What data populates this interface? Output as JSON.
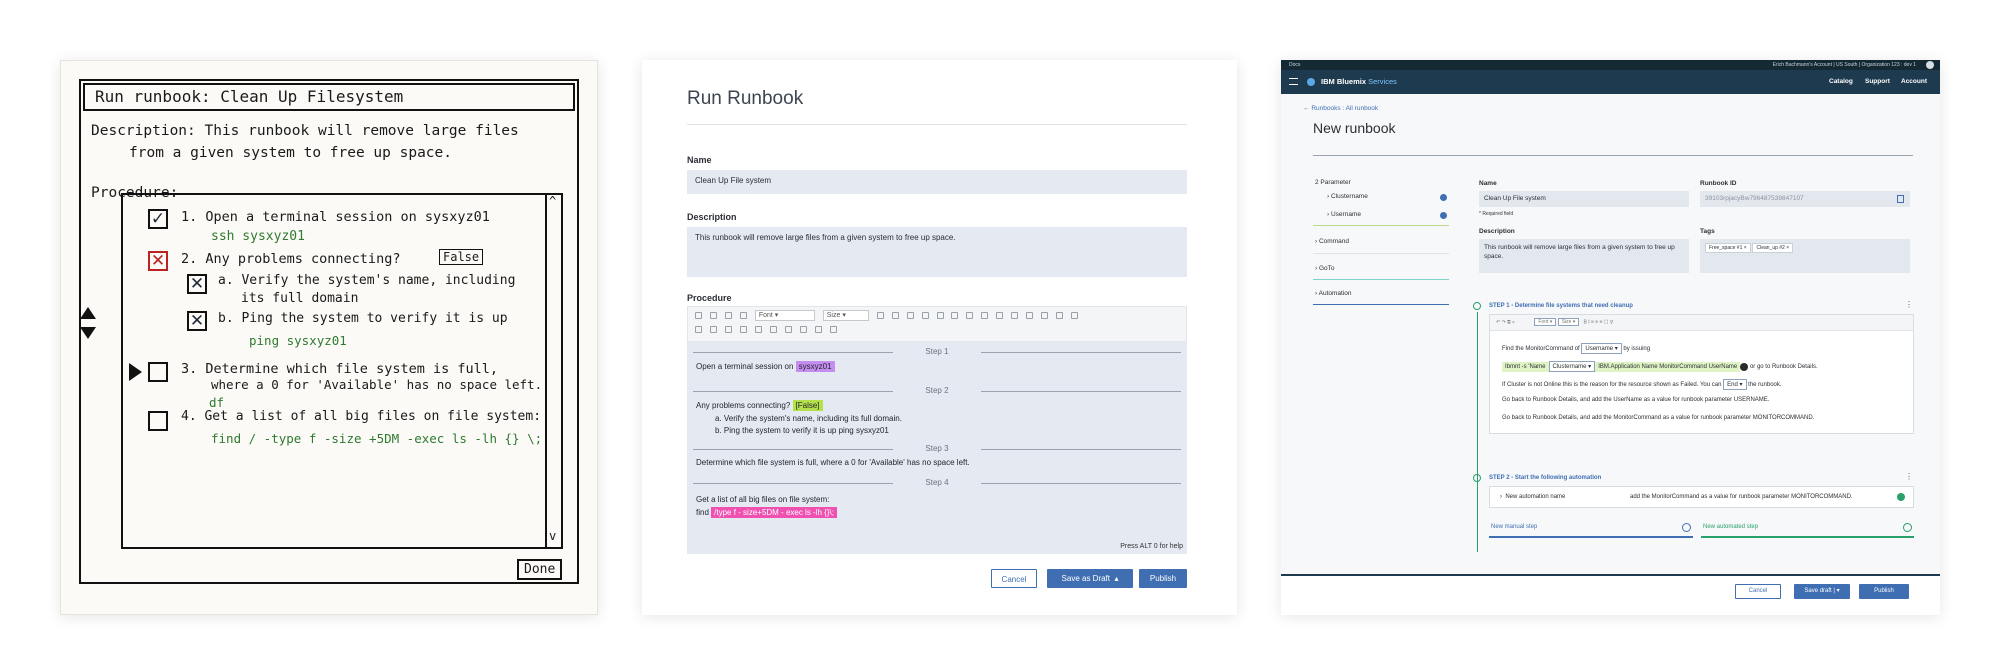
{
  "sketch": {
    "title": "Run runbook: Clean Up Filesystem",
    "description_line1": "Description: This runbook will remove large files",
    "description_line2": "from a given system to free up space.",
    "procedure_label": "Procedure:",
    "step1": "1. Open a terminal session on sysxyz01",
    "step1_cmd": "ssh sysxyz01",
    "step2": "2. Any problems connecting?",
    "step2_flag": "False",
    "step2a_line1": "a. Verify the system's name, including",
    "step2a_line2": "its full domain",
    "step2b": "b. Ping the system to verify it is up",
    "step2b_cmd": "ping sysxyz01",
    "step3_line1": "3. Determine which file system is full,",
    "step3_line2": "where a 0 for 'Available' has no space left.",
    "step3_cmd": "df",
    "step4": "4. Get a list of all big files on file system:",
    "step4_cmd": "find / -type f -size +5DM -exec ls -lh {} \\;",
    "scroll_up": "^",
    "scroll_down": "v",
    "done_label": "Done"
  },
  "middle": {
    "title": "Run Runbook",
    "name_label": "Name",
    "name_value": "Clean Up File system",
    "description_label": "Description",
    "description_value": "This runbook will remove large files from a given system to free up space.",
    "procedure_label": "Procedure",
    "toolbar": {
      "font": "Font",
      "size": "Size"
    },
    "steps": [
      {
        "label": "Step 1"
      },
      {
        "label": "Step 2"
      },
      {
        "label": "Step 3"
      },
      {
        "label": "Step 4"
      }
    ],
    "step1_text": "Open a terminal session on",
    "step1_chip": "sysxyz01",
    "step2_text": "Any problems connecting?",
    "step2_chip": "[False]",
    "step2_a": "a. Verify the system's name, including its full domain.",
    "step2_b": "b. Ping the system to verify it is up ping sysxyz01",
    "step3_text": "Determine which file system is full, where a 0 for 'Available' has no space left.",
    "step4_text": "Get a list of all big files on file system:",
    "step4_prefix": "find",
    "step4_chip": "/type f - size+5DM - exec ls -lh {}\\;",
    "help_text": "Press ALT 0 for help",
    "cancel_label": "Cancel",
    "draft_label": "Save as Draft",
    "publish_label": "Publish",
    "colors": {
      "chip_purple": "#c58df0",
      "chip_green": "#b6e04a",
      "chip_pink": "#f051b1",
      "primary": "#3f6fb2"
    }
  },
  "right": {
    "topbar_left": "Docs",
    "topbar_right": "Erich Bachmann's Account | US South | Organization 123 : dev 1",
    "brand": "IBM Bluemix",
    "brand_suffix": "Services",
    "nav": [
      "Catalog",
      "Support",
      "Account"
    ],
    "breadcrumb": "Runbooks : All runbook",
    "page_title": "New runbook",
    "side": {
      "parameter": "2  Parameter",
      "clustername": "Clustername",
      "username": "Username",
      "command": "Command",
      "goto": "GoTo",
      "automation": "Automation"
    },
    "name_label": "Name",
    "name_value": "Clean Up File system",
    "required": "* Required field",
    "id_label": "Runbook ID",
    "id_value": "39103rpjacyBw796487539847107",
    "desc_label": "Description",
    "desc_value": "This runbook will remove large files from a given system to free up space.",
    "tags_label": "Tags",
    "tags": [
      "Free_space #1 ×",
      "Clean_up #2 ×"
    ],
    "step1_title": "STEP 1 - Determine file systems that need cleanup",
    "toolbar": {
      "font": "Font",
      "size": "Size"
    },
    "s1_line1_a": "Find the MonitorCommand of",
    "s1_line1_sel": "Username",
    "s1_line1_b": "by issuing",
    "s1_cmd_a": "Ibmnt -s 'Name",
    "s1_cmd_sel": "Clustername",
    "s1_cmd_b": "IBM.Application Name MonitorCommand UserName",
    "s1_cmd_c": "or go to Runbook Details.",
    "s1_line3_a": "If Cluster is not Online this is the reason for the resource shown as Failed. You can",
    "s1_line3_sel": "End",
    "s1_line3_b": "the runbook.",
    "s1_line4": "Go back to Runbook Details, and add the UserName as a value for runbook parameter USERNAME.",
    "s1_line5": "Go back to Runbook Details, and add the MonitorCommand as a value for runbook parameter MONITORCOMMAND.",
    "step2_title": "STEP 2 - Start the following automation",
    "automation_name": "New automation name",
    "automation_desc": "add the MonitorCommand as a value for runbook parameter MONITORCOMMAND.",
    "new_manual": "New manual step",
    "new_automated": "New automated step",
    "cancel_label": "Cancel",
    "draft_label": "Save draft",
    "publish_label": "Publish"
  }
}
